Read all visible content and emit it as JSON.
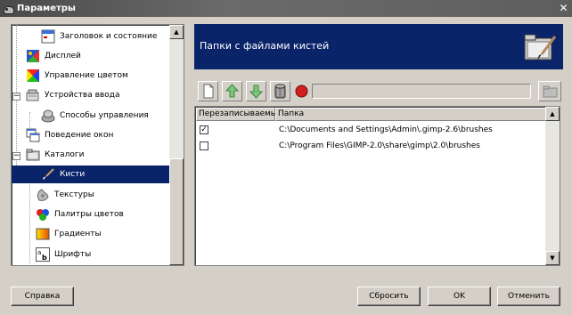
{
  "window": {
    "title": "Параметры"
  },
  "tree": {
    "items": [
      {
        "label": "Заголовок и состояние",
        "icon": "titlebar-icon"
      },
      {
        "label": "Дисплей",
        "icon": "display-icon"
      },
      {
        "label": "Управление цветом",
        "icon": "color-management-icon"
      },
      {
        "label": "Устройства ввода",
        "icon": "input-devices-icon"
      },
      {
        "label": "Способы управления",
        "icon": "input-controllers-icon"
      },
      {
        "label": "Поведение окон",
        "icon": "window-management-icon"
      },
      {
        "label": "Каталоги",
        "icon": "folders-icon"
      },
      {
        "label": "Кисти",
        "icon": "brush-icon",
        "selected": true
      },
      {
        "label": "Текстуры",
        "icon": "pattern-icon"
      },
      {
        "label": "Палитры цветов",
        "icon": "palette-icon"
      },
      {
        "label": "Градиенты",
        "icon": "gradient-icon"
      },
      {
        "label": "Шрифты",
        "icon": "font-icon"
      }
    ]
  },
  "panel": {
    "title": "Папки с файлами кистей",
    "icon": "folder-brush-icon",
    "toolbar": {
      "buttons": [
        "new-folder-icon",
        "move-up-icon",
        "move-down-icon",
        "delete-icon",
        "record-icon"
      ],
      "browse_icon": "browse-folder-icon",
      "path_value": ""
    },
    "columns": {
      "writable": "Перезаписываемый",
      "folder": "Папка"
    },
    "rows": [
      {
        "checked": true,
        "path": "C:\\Documents and Settings\\Admin\\.gimp-2.6\\brushes"
      },
      {
        "checked": false,
        "path": "C:\\Program Files\\GIMP-2.0\\share\\gimp\\2.0\\brushes"
      }
    ]
  },
  "buttons": {
    "help": "Справка",
    "reset": "Сбросить",
    "ok": "OK",
    "cancel": "Отменить"
  },
  "colors": {
    "selection": "#0a246a",
    "banner": "#0a246a",
    "face": "#d4d0c8"
  }
}
